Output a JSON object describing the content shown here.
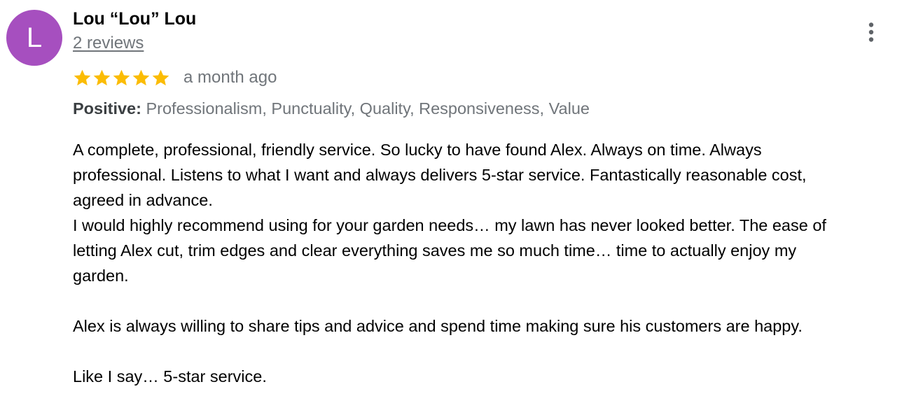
{
  "reviewer": {
    "initial": "L",
    "name": "Lou “Lou” Lou",
    "reviews_link": "2 reviews",
    "avatar_color": "#a64fbf"
  },
  "menu_icon": "more-vertical-icon",
  "rating": {
    "stars": 5,
    "max_stars": 5,
    "star_color": "#fbbc04",
    "time": "a month ago"
  },
  "positives": {
    "label": "Positive:",
    "values": "Professionalism, Punctuality, Quality, Responsiveness, Value"
  },
  "review": {
    "paragraph_1": "A complete, professional, friendly service. So lucky to have found Alex. Always on time. Always\nprofessional. Listens to what I want and always delivers 5-star service. Fantastically reasonable cost,\nagreed in advance.\nI would highly recommend using for your garden needs… my lawn has never looked better. The ease of\nletting Alex cut, trim edges and clear everything saves me so much time… time to actually enjoy my\ngarden.",
    "paragraph_2": "Alex is always willing to share tips and advice and spend time making sure his customers are happy.",
    "paragraph_3": "Like I say… 5-star service."
  }
}
